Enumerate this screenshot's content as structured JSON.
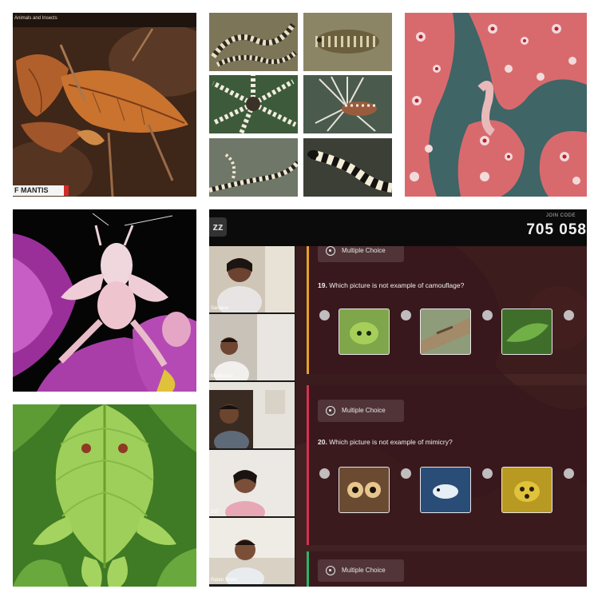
{
  "collage": {
    "leaf_mantis": {
      "caption": "Animals and Insects",
      "banner": "F MANTIS"
    },
    "quiz": {
      "logo": "zz",
      "join_label": "JOIN CODE",
      "join_code": "705 058",
      "participants": [
        {
          "name": "Sanjana"
        },
        {
          "name": "Madhavan"
        },
        {
          "name": ""
        },
        {
          "name": "207"
        },
        {
          "name": "Ratan Shew"
        }
      ],
      "question_type_label": "Multiple Choice",
      "questions": [
        {
          "number": "19.",
          "text": "Which picture is not example of camouflage?",
          "accent": "#e3a12b"
        },
        {
          "number": "20.",
          "text": "Which picture is not example of mimicry?",
          "accent": "#d1334e"
        }
      ],
      "third_card_accent": "#2db36a"
    }
  },
  "colors": {
    "background": "#ffffff",
    "quiz_dark": "#2b1417"
  }
}
